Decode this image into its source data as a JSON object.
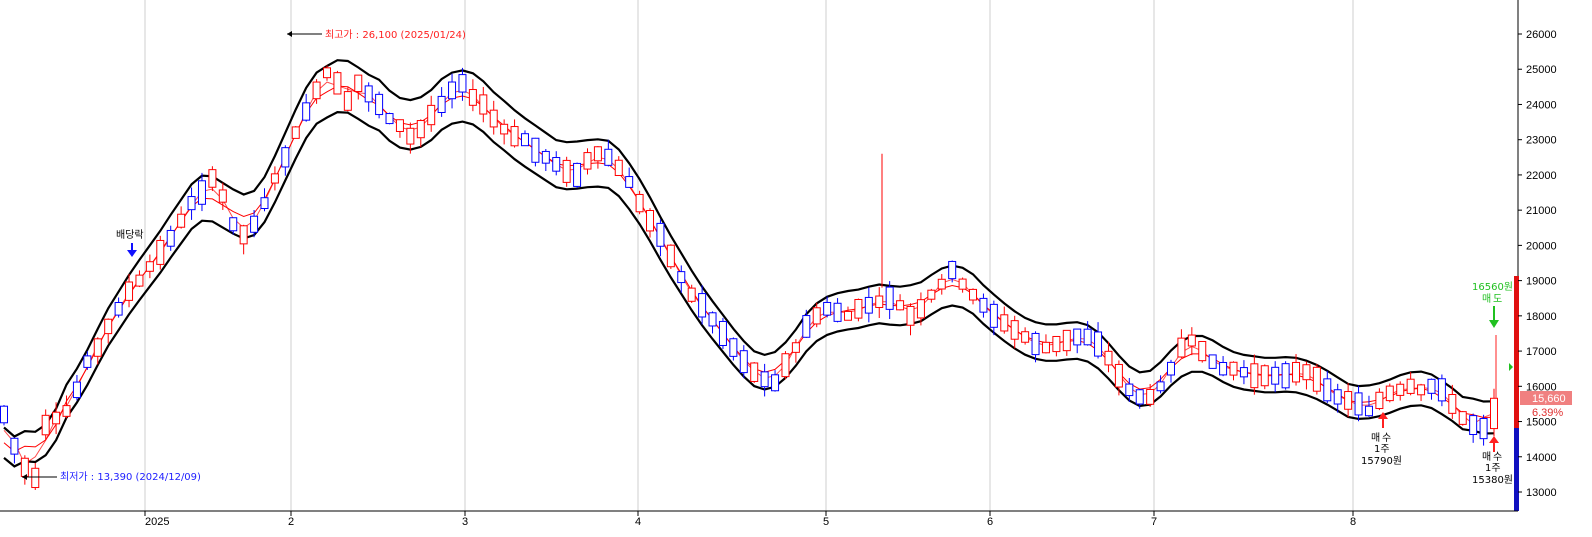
{
  "chart_data": {
    "type": "candlestick",
    "y_axis": {
      "range": [
        12800,
        26700
      ],
      "ticks": [
        13000,
        14000,
        15000,
        16000,
        17000,
        18000,
        19000,
        20000,
        21000,
        22000,
        23000,
        24000,
        25000,
        26000
      ],
      "tick_labels": [
        "13000",
        "14000",
        "15000",
        "16000",
        "17000",
        "18000",
        "19000",
        "20000",
        "21000",
        "22000",
        "23000",
        "24000",
        "25000",
        "26000"
      ],
      "position": "right"
    },
    "x_axis": {
      "labels": [
        "2025",
        "2",
        "3",
        "4",
        "5",
        "6",
        "7",
        "8"
      ]
    },
    "grid": "vertical",
    "colors": {
      "up": "#ff0000",
      "down": "#0000ff",
      "band": "#000000",
      "ma": "#ff0000",
      "target": "#20c020"
    },
    "current_price_label": "15,660",
    "change_pct_label": "6.39%",
    "series": [
      {
        "name": "",
        "values": [
          15200,
          14300,
          13700,
          13400,
          14900,
          15100,
          15300,
          15900,
          16700,
          17100,
          17700,
          18200,
          18700,
          19000,
          19400,
          19800,
          20200,
          20700,
          21200,
          21500,
          21900,
          21400,
          20600,
          20300,
          20600,
          21200,
          21900,
          22500,
          23200,
          23800,
          24400,
          24900,
          24600,
          24100,
          24600,
          24300,
          24000,
          23600,
          23400,
          23100,
          23300,
          23700,
          24000,
          24400,
          24600,
          24200,
          24000,
          23600,
          23300,
          23100,
          23000,
          22700,
          22500,
          22300,
          22100,
          22000,
          22400,
          22600,
          22500,
          22200,
          21800,
          21200,
          20700,
          20300,
          19700,
          19100,
          18600,
          18300,
          17900,
          17500,
          17100,
          16700,
          16400,
          16200,
          16100,
          16600,
          17100,
          17700,
          18000,
          18200,
          18100,
          18000,
          18200,
          18300,
          18400,
          18500,
          18300,
          18000,
          18200,
          18600,
          18900,
          19300,
          18900,
          18600,
          18300,
          18000,
          17800,
          17600,
          17400,
          17200,
          17100,
          17200,
          17300,
          17400,
          17400,
          17200,
          16800,
          16300,
          15900,
          15700,
          15700,
          16000,
          16500,
          17100,
          17300,
          17000,
          16700,
          16500,
          16500,
          16400,
          16300,
          16300,
          16300,
          16300,
          16400,
          16400,
          16200,
          15900,
          15700,
          15600,
          15500,
          15300,
          15600,
          15800,
          15900,
          16000,
          15900,
          16000,
          15900,
          15500,
          15100,
          14900,
          14800,
          15660
        ]
      }
    ],
    "annotations": {
      "high": "최고가 : 26,100 (2025/01/24)",
      "low": "최저가 : 13,390 (2024/12/09)",
      "dividend": "배당락",
      "buy1_line1": "매",
      "buy1_line2": "수",
      "buy1_line3": "1주",
      "buy1_price": "15790원",
      "buy2_line1": "매",
      "buy2_line2": "수",
      "buy2_line3": "1주",
      "buy2_price": "15380원",
      "sell_price": "16560원",
      "sell_line1": "매",
      "sell_line2": "도"
    }
  }
}
